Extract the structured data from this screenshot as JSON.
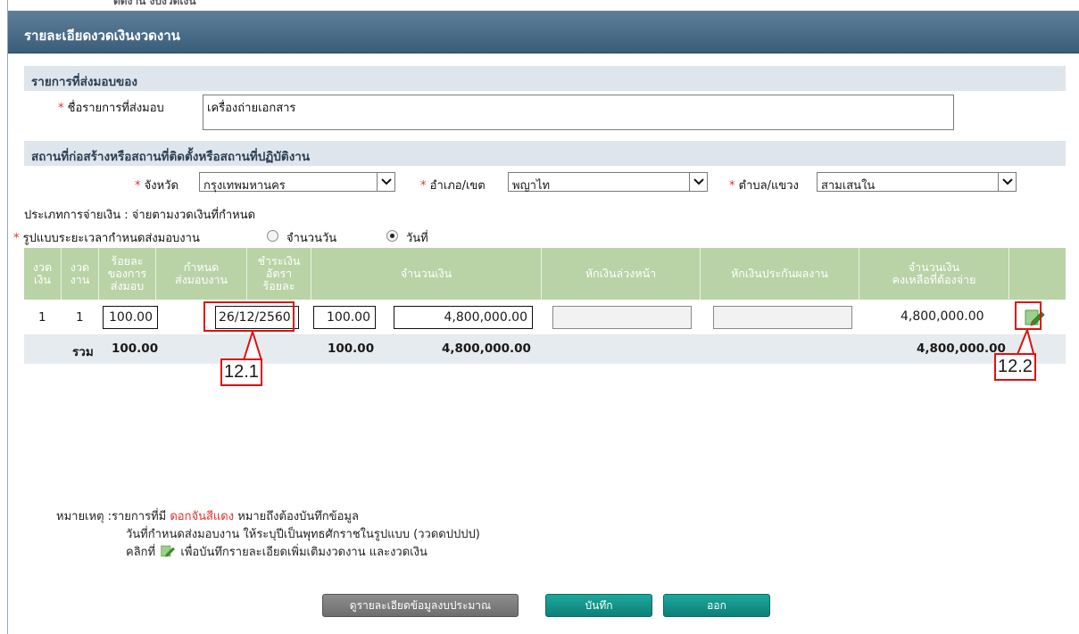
{
  "peek_text": "ตดงาน งบงวดเงน",
  "window": {
    "title": "รายละเอียดงวดเงินงวดงาน"
  },
  "section1": {
    "title": "รายการที่ส่งมอบของ",
    "item_label": "ชื่อรายการที่ส่งมอบ",
    "item_value": "เครื่องถ่ายเอกสาร"
  },
  "section2": {
    "title": "สถานที่ก่อสร้างหรือสถานที่ติดตั้งหรือสถานที่ปฏิบัติงาน",
    "province_label": "จังหวัด",
    "province_value": "กรุงเทพมหานคร",
    "district_label": "อำเภอ/เขต",
    "district_value": "พญาไท",
    "subdistrict_label": "ตำบล/แขวง",
    "subdistrict_value": "สามเสนใน"
  },
  "payment_type": "ประเภทการจ่ายเงิน : จ่ายตามงวดเงินที่กำหนด",
  "period_format": {
    "label": "รูปแบบระยะเวลากำหนดส่งมอบงาน",
    "option_days": "จำนวนวัน",
    "option_date": "วันที่",
    "selected": "วันที่"
  },
  "required_mark": "*",
  "table": {
    "headers": [
      "งวด\nเงิน",
      "งวด\nงาน",
      "ร้อยละ\nของการ\nส่งมอบ",
      "กำหนด\nส่งมอบงาน",
      "ชำระเงิน\nอัตรา\nร้อยละ",
      "จำนวนเงิน",
      "หักเงินล่วงหน้า",
      "หักเงินประกันผลงาน",
      "จำนวนเงิน\nคงเหลือที่ต้องจ่าย",
      ""
    ],
    "row": {
      "money_period": "1",
      "work_period": "1",
      "percent": "100.00",
      "due_date": "26/12/2560",
      "pay_percent": "100.00",
      "amount": "4,800,000.00",
      "advance": "",
      "guarantee": "",
      "remaining": "4,800,000.00"
    },
    "totals": {
      "label": "รวม",
      "percent": "100.00",
      "pay_percent": "100.00",
      "amount": "4,800,000.00",
      "remaining": "4,800,000.00"
    }
  },
  "callouts": {
    "c1": "12.1",
    "c2": "12.2"
  },
  "notes": {
    "prefix": "หมายเหตุ :รายการที่มี ",
    "red": "ดอกจันสีแดง",
    "suffix": " หมายถึงต้องบันทึกข้อมูล",
    "line2": "วันที่กำหนดส่งมอบงาน ให้ระบุปีเป็นพุทธศักราชในรูปแบบ (ววดดปปปป)",
    "line3_prefix": "คลิกที่ ",
    "line3_suffix": " เพื่อบันทึกรายละเอียดเพิ่มเติมงวดงาน และงวดเงิน"
  },
  "buttons": {
    "budget": "ดูรายละเอียดข้อมูลงบประมาณ",
    "save": "บันทึก",
    "exit": "ออก"
  },
  "colors": {
    "title_bar": "#4a6d89",
    "section_bg": "#dfe5ec",
    "table_header": "#b9d3a6",
    "accent_red": "#e01010",
    "button_teal": "#12958c"
  }
}
